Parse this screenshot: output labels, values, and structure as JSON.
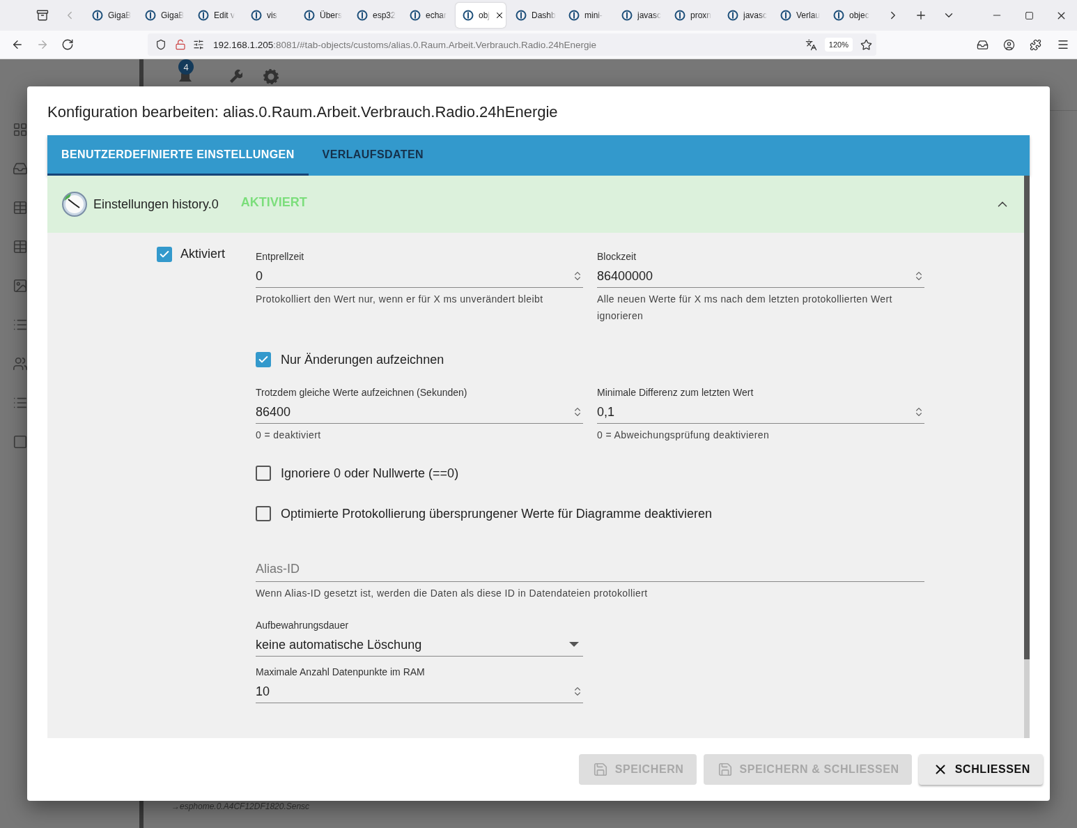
{
  "browser": {
    "tabs": [
      {
        "title": "GigaB",
        "selected": false
      },
      {
        "title": "GigaB",
        "selected": false
      },
      {
        "title": "Edit v",
        "selected": false
      },
      {
        "title": "vis",
        "selected": false
      },
      {
        "title": "Übers",
        "selected": false
      },
      {
        "title": "esp32",
        "selected": false
      },
      {
        "title": "echar",
        "selected": false
      },
      {
        "title": "obj",
        "selected": true
      },
      {
        "title": "Dashb",
        "selected": false
      },
      {
        "title": "mini-",
        "selected": false
      },
      {
        "title": "javasc",
        "selected": false
      },
      {
        "title": "proxn",
        "selected": false
      },
      {
        "title": "javasc",
        "selected": false
      },
      {
        "title": "Verlau",
        "selected": false
      },
      {
        "title": "objec",
        "selected": false
      }
    ],
    "url": {
      "host": "192.168.1.205",
      "rest": ":8081/#tab-objects/customs/alias.0.Raum.Arbeit.Verbrauch.Radio.24hEnergie"
    },
    "zoom": "120%"
  },
  "background": {
    "badge": "4",
    "footer_text": "→esphome.0.A4CF12DF1820.Sensc"
  },
  "dialog": {
    "title": "Konfiguration bearbeiten: alias.0.Raum.Arbeit.Verbrauch.Radio.24hEnergie",
    "tabs": [
      {
        "label": "BENUTZERDEFINIERTE EINSTELLUNGEN",
        "selected": true
      },
      {
        "label": "VERLAUFSDATEN",
        "selected": false
      }
    ],
    "section": {
      "title": "Einstellungen history.0",
      "status": "AKTIVIERT",
      "expanded": true
    },
    "enabled": {
      "label": "Aktiviert",
      "checked": true
    },
    "rows": [
      {
        "items": [
          {
            "kind": "number",
            "label": "Entprellzeit",
            "value": "0",
            "helper": "Protokolliert den Wert nur, wenn er für X ms unverändert bleibt"
          },
          {
            "kind": "number",
            "label": "Blockzeit",
            "value": "86400000",
            "helper": "Alle neuen Werte für X ms nach dem letzten protokollierten Wert ignorieren"
          }
        ]
      },
      {
        "items": [
          {
            "kind": "checkbox",
            "label": "Nur Änderungen aufzeichnen",
            "checked": true
          }
        ]
      },
      {
        "items": [
          {
            "kind": "number",
            "label": "Trotzdem gleiche Werte aufzeichnen (Sekunden)",
            "value": "86400",
            "helper": "0 = deaktiviert"
          },
          {
            "kind": "number",
            "label": "Minimale Differenz zum letzten Wert",
            "value": "0,1",
            "helper": "0 = Abweichungsprüfung deaktivieren"
          }
        ]
      },
      {
        "items": [
          {
            "kind": "checkbox",
            "label": "Ignoriere 0 oder Nullwerte (==0)",
            "checked": false
          }
        ]
      },
      {
        "items": [
          {
            "kind": "checkbox",
            "label": "Optimierte Protokollierung übersprungener Werte für Diagramme deaktivieren",
            "checked": false
          }
        ]
      },
      {
        "items": [
          {
            "kind": "text",
            "placeholder": "Alias-ID",
            "helper": "Wenn Alias-ID gesetzt ist, werden die Daten als diese ID in Datendateien protokolliert"
          }
        ]
      },
      {
        "items": [
          {
            "kind": "select",
            "label": "Aufbewahrungsdauer",
            "value": "keine automatische Löschung"
          }
        ]
      },
      {
        "items": [
          {
            "kind": "number",
            "label": "Maximale Anzahl Datenpunkte im RAM",
            "value": "10"
          }
        ]
      }
    ],
    "buttons": [
      {
        "kind": "save",
        "label": "SPEICHERN",
        "disabled": true
      },
      {
        "kind": "save",
        "label": "SPEICHERN & SCHLIESSEN",
        "disabled": true
      },
      {
        "kind": "close",
        "label": "SCHLIESSEN",
        "disabled": false
      }
    ]
  }
}
